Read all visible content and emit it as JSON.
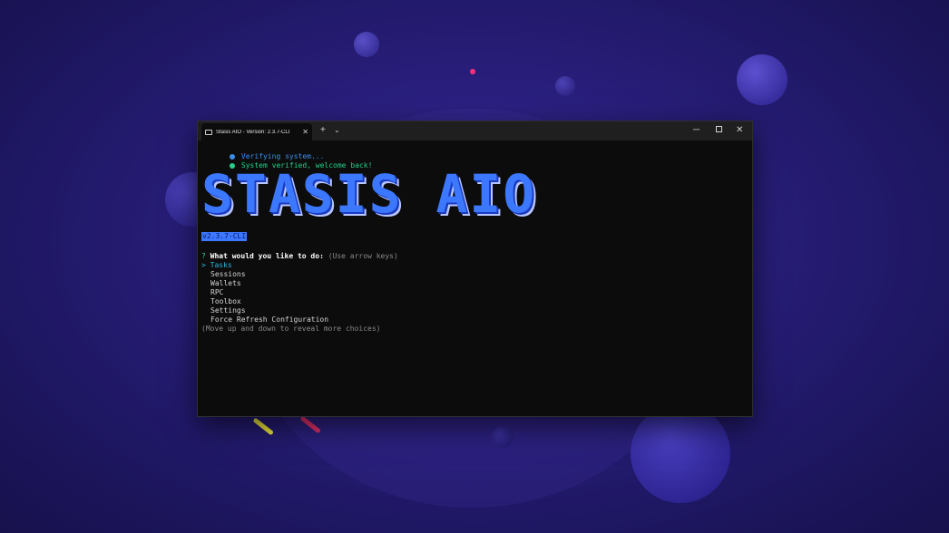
{
  "terminal": {
    "tab_title": "Stasis AIO - Version: 2.3.7-CLI",
    "new_tab": "+",
    "tab_dropdown": "⌄",
    "win_minimize": "─",
    "win_close": "✕",
    "status_lines": [
      {
        "text": "Verifying system...",
        "color": "#3b8eea"
      },
      {
        "text": "System verified, welcome back!",
        "color": "#23d18b"
      }
    ],
    "logo_text": "STASIS AIO",
    "version_badge": "v2.3.7-CLI",
    "prompt": {
      "marker": "?",
      "question": "What would you like to do:",
      "hint": "(Use arrow keys)"
    },
    "menu": {
      "pointer": ">",
      "selected": "Tasks",
      "items": [
        "Sessions",
        "Wallets",
        "RPC",
        "Toolbox",
        "Settings",
        "Force Refresh Configuration"
      ],
      "footer": "(Move up and down to reveal more choices)"
    }
  },
  "colors": {
    "accent_blue": "#3b78ff",
    "success_green": "#23d18b",
    "info_blue": "#3b8eea",
    "background": "#2a1f7e"
  }
}
